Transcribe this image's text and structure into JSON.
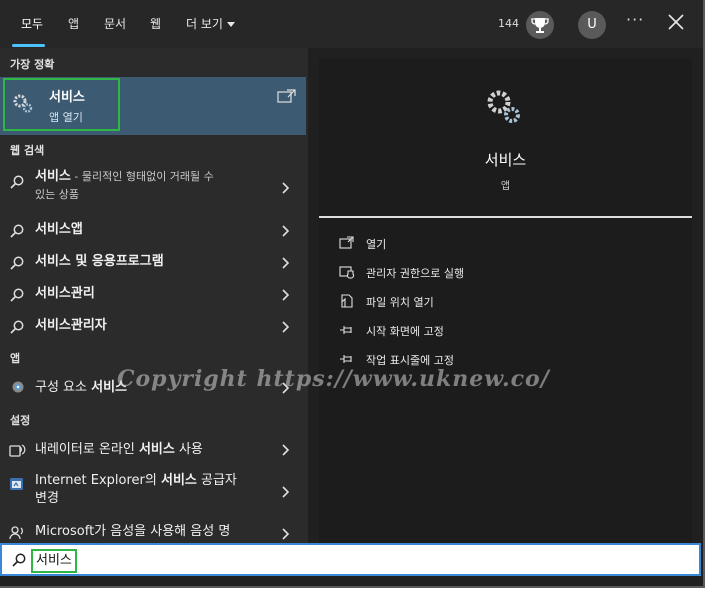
{
  "tabs": [
    {
      "label": "모두",
      "active": true
    },
    {
      "label": "앱"
    },
    {
      "label": "문서"
    },
    {
      "label": "웹"
    },
    {
      "label": "더 보기"
    }
  ],
  "header": {
    "points": "144",
    "avatar_initial": "U"
  },
  "left": {
    "section_best": "가장 정확",
    "best": {
      "title": "서비스",
      "subtitle": "앱 열기"
    },
    "section_web": "웹 검색",
    "web": [
      {
        "bold": "서비스",
        "rest": " - 물리적인 형태없이 거래될 수",
        "line2": "있는 상품"
      },
      {
        "bold": "서비스",
        "rest": "앱"
      },
      {
        "bold": "서비스",
        "rest": " 및 응용프로그램"
      },
      {
        "bold": "서비스",
        "rest": "관리"
      },
      {
        "bold": "서비스",
        "rest": "관리자"
      }
    ],
    "section_apps": "앱",
    "apps": [
      {
        "pre": "구성 요소 ",
        "bold": "서비스"
      }
    ],
    "section_settings": "설정",
    "settings": [
      {
        "pre": "내레이터로 온라인 ",
        "bold": "서비스",
        "post": " 사용"
      },
      {
        "pre": "Internet Explorer의 ",
        "bold": "서비스",
        "post": " 공급자",
        "line2": "변경"
      },
      {
        "pre": "Microsoft가 음성을 사용해 음성 명"
      }
    ]
  },
  "right": {
    "title": "서비스",
    "subtitle": "앱",
    "actions": [
      {
        "label": "열기",
        "icon": "open-icon"
      },
      {
        "label": "관리자 권한으로 실행",
        "icon": "shield-icon"
      },
      {
        "label": "파일 위치 열기",
        "icon": "file-location-icon"
      },
      {
        "label": "시작 화면에 고정",
        "icon": "pin-icon"
      },
      {
        "label": "작업 표시줄에 고정",
        "icon": "pin-icon"
      }
    ]
  },
  "search": {
    "value": "서비스"
  },
  "watermark": "Copyright https://www.uknew.co/",
  "colors": {
    "accent": "#4cc2ff",
    "selected": "#3c5a72",
    "highlight_box": "#2fb745"
  }
}
